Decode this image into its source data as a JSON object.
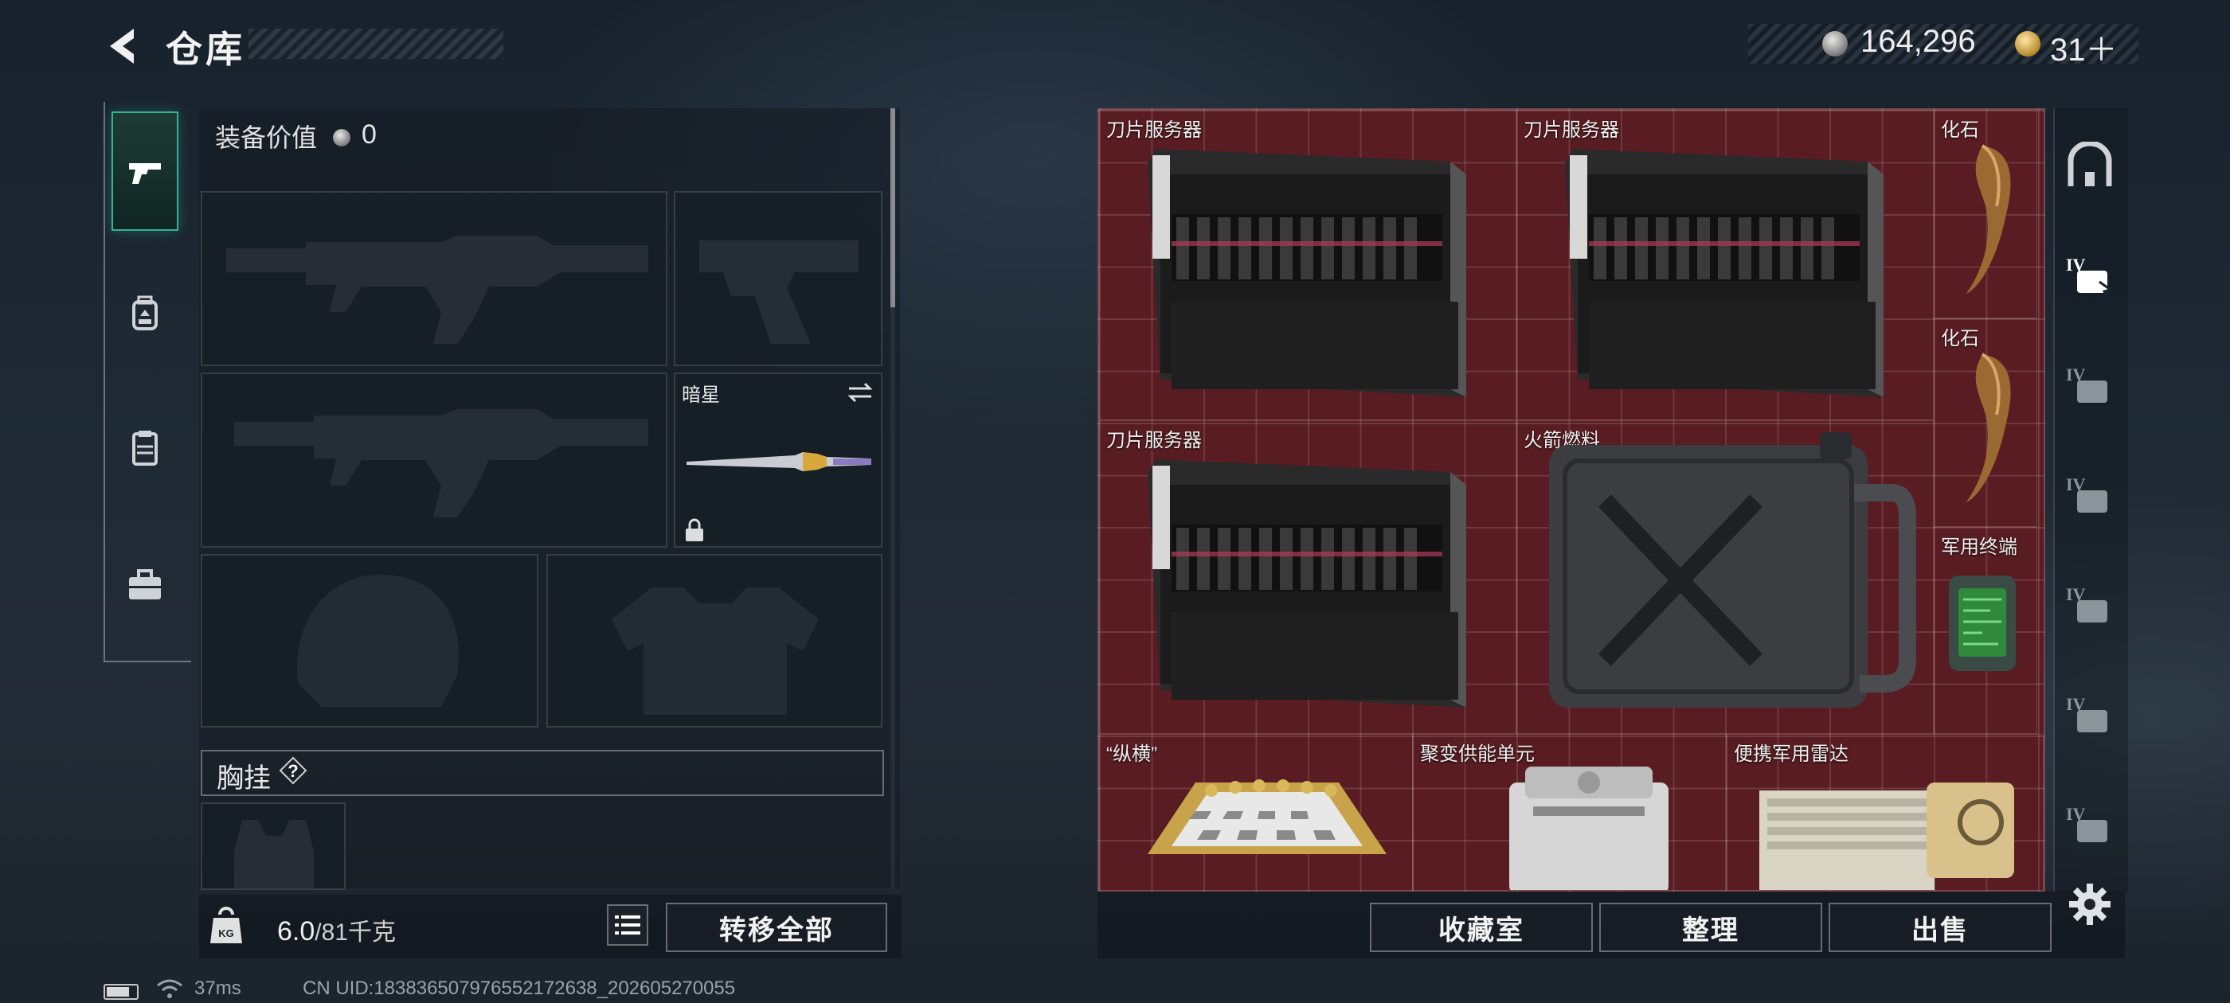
{
  "header": {
    "title": "仓库",
    "back_icon": "back-chevron-icon"
  },
  "currency": {
    "silver_amount": "164,296",
    "gold_amount": "31＋",
    "silver_icon": "silver-coin-icon",
    "gold_icon": "gold-coin-icon"
  },
  "left_tabs": [
    {
      "icon": "pistol-icon",
      "active": true
    },
    {
      "icon": "backpack-icon",
      "active": false
    },
    {
      "icon": "vest-icon",
      "active": false
    },
    {
      "icon": "toolbox-icon",
      "active": false
    }
  ],
  "loadout": {
    "equip_value_label": "装备价值",
    "equip_value": "0",
    "melee_slot_label": "暗星",
    "chest_rig_label": "胸挂",
    "help_mark": "?"
  },
  "footer_left": {
    "weight_current": "6.0",
    "weight_capacity": "/81千克",
    "weight_icon_text": "KG",
    "transfer_all_label": "转移全部"
  },
  "stash": {
    "items": [
      {
        "name": "刀片服务器"
      },
      {
        "name": "刀片服务器"
      },
      {
        "name": "化石"
      },
      {
        "name": "化石"
      },
      {
        "name": "刀片服务器"
      },
      {
        "name": "火箭燃料"
      },
      {
        "name": "军用终端"
      },
      {
        "name": "“纵横”"
      },
      {
        "name": "聚变供能单元"
      },
      {
        "name": "便携军用雷达"
      }
    ],
    "buttons": {
      "collection": "收藏室",
      "organize": "整理",
      "sell": "出售"
    }
  },
  "right_rail": {
    "tier_label": "IV"
  },
  "status_bar": {
    "ping": "37ms",
    "uid": "CN UID:1838365079765521726​38_202605270055"
  },
  "colors": {
    "accent": "#2fb596",
    "stash_bg": "#581c22"
  }
}
